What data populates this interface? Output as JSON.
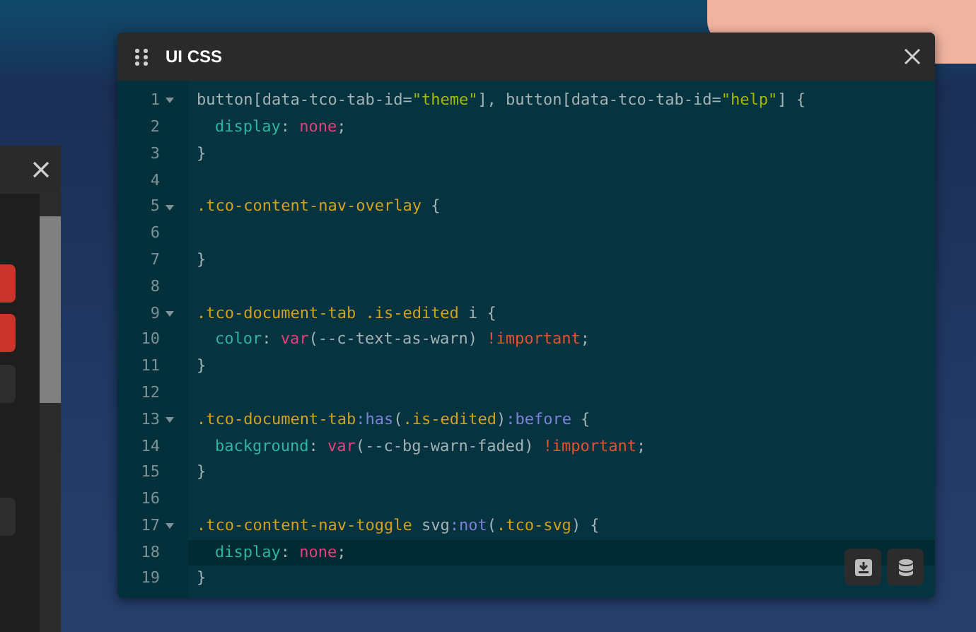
{
  "side_panel": {
    "buttons": [
      {
        "kind": "danger"
      },
      {
        "kind": "danger"
      },
      {
        "kind": "secondary"
      },
      {
        "kind": "secondary"
      }
    ]
  },
  "window": {
    "title": "UI CSS"
  },
  "editor": {
    "lines": [
      {
        "number": "1",
        "fold": true,
        "active": false,
        "indented": false,
        "tokens": [
          {
            "kind": "plain",
            "t": "button[data-tco-tab-id="
          },
          {
            "kind": "string",
            "t": "\"theme\""
          },
          {
            "kind": "plain",
            "t": "], button[data-tco-tab-id="
          },
          {
            "kind": "string",
            "t": "\"help\""
          },
          {
            "kind": "plain",
            "t": "] {"
          }
        ]
      },
      {
        "number": "2",
        "fold": false,
        "active": false,
        "indented": true,
        "tokens": [
          {
            "kind": "prop",
            "t": "display"
          },
          {
            "kind": "plain",
            "t": ": "
          },
          {
            "kind": "value",
            "t": "none"
          },
          {
            "kind": "plain",
            "t": ";"
          }
        ]
      },
      {
        "number": "3",
        "fold": false,
        "active": false,
        "indented": false,
        "tokens": [
          {
            "kind": "plain",
            "t": "}"
          }
        ]
      },
      {
        "number": "4",
        "fold": false,
        "active": false
      },
      {
        "number": "5",
        "fold": true,
        "active": false,
        "indented": false,
        "tokens": [
          {
            "kind": "sel",
            "t": ".tco-content-nav-overlay"
          },
          {
            "kind": "plain",
            "t": " {"
          }
        ]
      },
      {
        "number": "6",
        "fold": false,
        "active": false
      },
      {
        "number": "7",
        "fold": false,
        "active": false,
        "indented": false,
        "tokens": [
          {
            "kind": "plain",
            "t": "}"
          }
        ]
      },
      {
        "number": "8",
        "fold": false,
        "active": false
      },
      {
        "number": "9",
        "fold": true,
        "active": false,
        "indented": false,
        "tokens": [
          {
            "kind": "sel",
            "t": ".tco-document-tab .is-edited"
          },
          {
            "kind": "plain",
            "t": " i {"
          }
        ]
      },
      {
        "number": "10",
        "fold": false,
        "active": false,
        "indented": true,
        "tokens": [
          {
            "kind": "prop",
            "t": "color"
          },
          {
            "kind": "plain",
            "t": ": "
          },
          {
            "kind": "value",
            "t": "var"
          },
          {
            "kind": "plain",
            "t": "(--c-text-as-warn) "
          },
          {
            "kind": "important",
            "t": "!important"
          },
          {
            "kind": "plain",
            "t": ";"
          }
        ]
      },
      {
        "number": "11",
        "fold": false,
        "active": false,
        "indented": false,
        "tokens": [
          {
            "kind": "plain",
            "t": "}"
          }
        ]
      },
      {
        "number": "12",
        "fold": false,
        "active": false
      },
      {
        "number": "13",
        "fold": true,
        "active": false,
        "indented": false,
        "tokens": [
          {
            "kind": "sel",
            "t": ".tco-document-tab"
          },
          {
            "kind": "pseudo",
            "t": ":has"
          },
          {
            "kind": "plain",
            "t": "("
          },
          {
            "kind": "sel",
            "t": ".is-edited"
          },
          {
            "kind": "plain",
            "t": ")"
          },
          {
            "kind": "pseudo",
            "t": ":before"
          },
          {
            "kind": "plain",
            "t": " {"
          }
        ]
      },
      {
        "number": "14",
        "fold": false,
        "active": false,
        "indented": true,
        "tokens": [
          {
            "kind": "prop",
            "t": "background"
          },
          {
            "kind": "plain",
            "t": ": "
          },
          {
            "kind": "value",
            "t": "var"
          },
          {
            "kind": "plain",
            "t": "(--c-bg-warn-faded) "
          },
          {
            "kind": "important",
            "t": "!important"
          },
          {
            "kind": "plain",
            "t": ";"
          }
        ]
      },
      {
        "number": "15",
        "fold": false,
        "active": false,
        "indented": false,
        "tokens": [
          {
            "kind": "plain",
            "t": "}"
          }
        ]
      },
      {
        "number": "16",
        "fold": false,
        "active": false
      },
      {
        "number": "17",
        "fold": true,
        "active": false,
        "indented": false,
        "tokens": [
          {
            "kind": "sel",
            "t": ".tco-content-nav-toggle"
          },
          {
            "kind": "plain",
            "t": " svg"
          },
          {
            "kind": "pseudo",
            "t": ":not"
          },
          {
            "kind": "plain",
            "t": "("
          },
          {
            "kind": "sel",
            "t": ".tco-svg"
          },
          {
            "kind": "plain",
            "t": ") {"
          }
        ]
      },
      {
        "number": "18",
        "fold": false,
        "active": true,
        "indented": true,
        "tokens": [
          {
            "kind": "prop",
            "t": "display"
          },
          {
            "kind": "plain",
            "t": ": "
          },
          {
            "kind": "value",
            "t": "none"
          },
          {
            "kind": "plain",
            "t": ";"
          }
        ]
      },
      {
        "number": "19",
        "fold": false,
        "active": false,
        "indented": false,
        "tokens": [
          {
            "kind": "plain",
            "t": "}"
          }
        ]
      }
    ]
  }
}
